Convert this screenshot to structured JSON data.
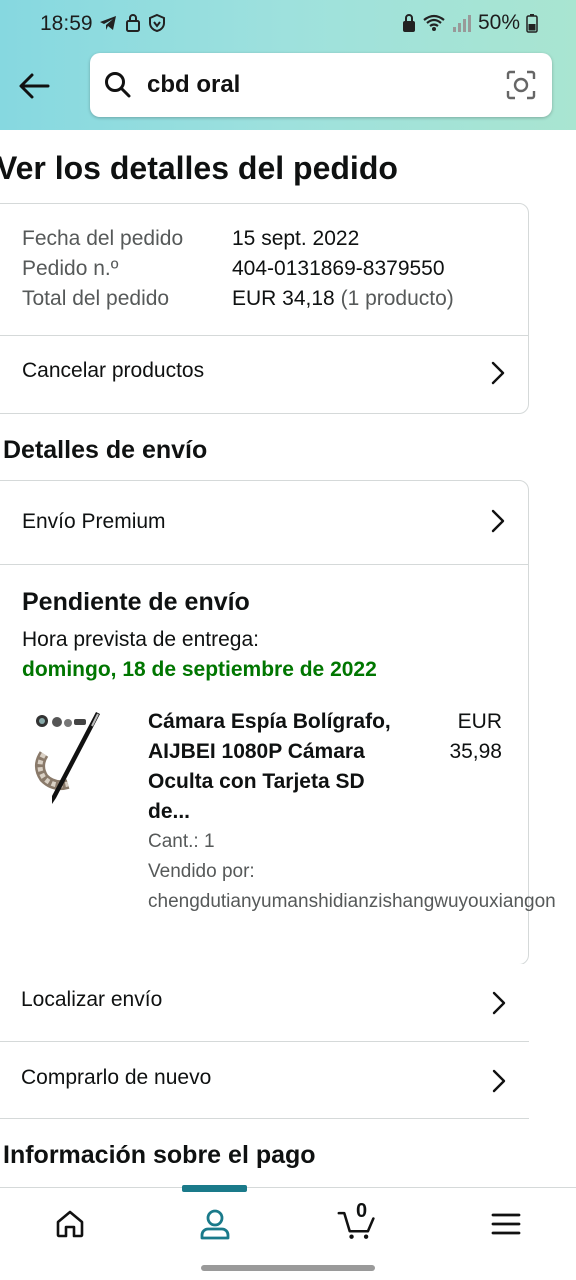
{
  "status": {
    "time": "18:59",
    "battery": "50%"
  },
  "search": {
    "query": "cbd oral"
  },
  "page": {
    "title": "Ver los detalles del pedido"
  },
  "order": {
    "date_label": "Fecha del pedido",
    "date_value": "15 sept. 2022",
    "number_label": "Pedido n.º",
    "number_value": "404-0131869-8379550",
    "total_label": "Total del pedido",
    "total_value": "EUR 34,18",
    "total_count": "(1 producto)",
    "cancel_label": "Cancelar productos"
  },
  "shipping": {
    "heading": "Detalles de envío",
    "method": "Envío Premium",
    "status": "Pendiente de envío",
    "eta_label": "Hora prevista de entrega:",
    "eta_date": "domingo, 18 de septiembre de 2022",
    "product": {
      "title": "Cámara Espía Bolígrafo, AIJBEI 1080P Cámara Oculta con Tarjeta SD de...",
      "price_currency": "EUR",
      "price_amount": "35,98",
      "qty": "Cant.: 1",
      "sold_by_label": "Vendido por:",
      "seller": "chengdutianyumanshidianzishangwuyouxiangon"
    },
    "track_label": "Localizar envío",
    "buy_again_label": "Comprarlo de nuevo"
  },
  "payment": {
    "heading": "Información sobre el pago"
  },
  "cart": {
    "count": "0"
  },
  "icons": {
    "back": "arrow-left-icon",
    "search": "search-icon",
    "camera": "camera-scan-icon",
    "home": "home-icon",
    "account": "person-icon",
    "cart": "cart-icon",
    "menu": "menu-icon",
    "chevron": "chevron-right-icon"
  },
  "colors": {
    "header_gradient_start": "#86d8e0",
    "header_gradient_end": "#a9e5d1",
    "delivery_green": "#007600",
    "nav_active": "#1a7a8a"
  }
}
